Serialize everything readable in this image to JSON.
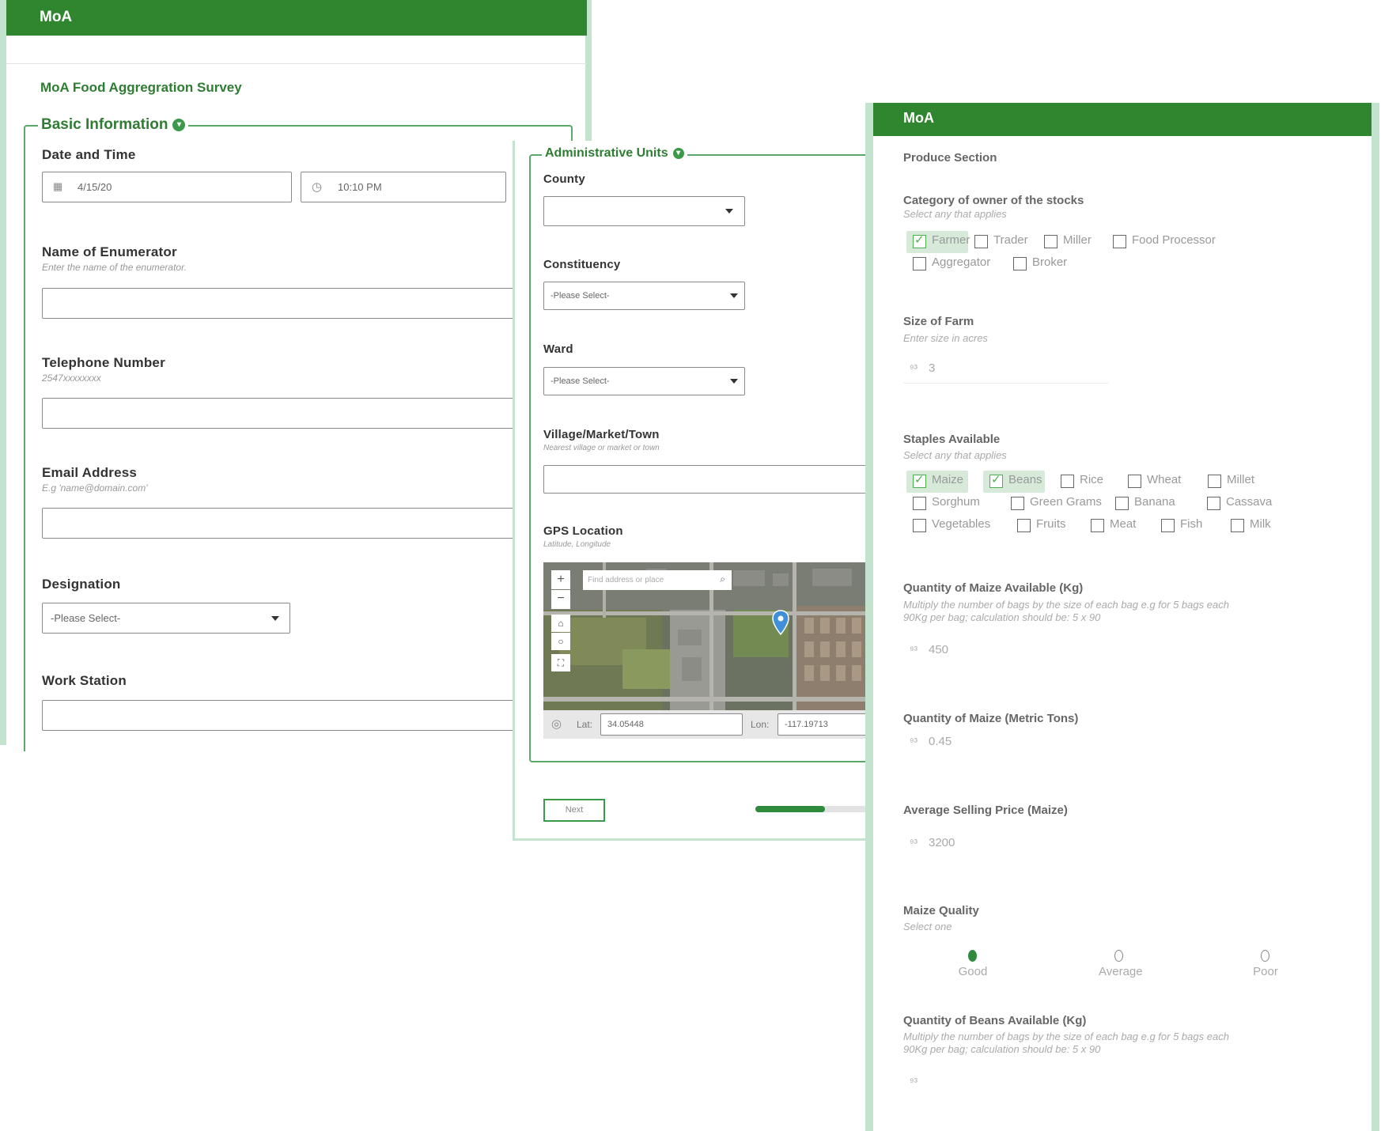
{
  "left_form": {
    "app_title": "MoA",
    "survey_title": "MoA Food Aggregration Survey",
    "section_title": "Basic Information",
    "date_time": {
      "label": "Date and Time",
      "date_value": "4/15/20",
      "time_value": "10:10 PM"
    },
    "enumerator": {
      "label": "Name of Enumerator",
      "hint": "Enter the name of the enumerator."
    },
    "telephone": {
      "label": "Telephone Number",
      "hint": "2547xxxxxxxx"
    },
    "email": {
      "label": "Email Address",
      "hint": "E.g 'name@domain.com'"
    },
    "designation": {
      "label": "Designation",
      "value": "-Please Select-"
    },
    "work_station": {
      "label": "Work Station"
    }
  },
  "middle_form": {
    "section_title": "Administrative Units",
    "county": {
      "label": "County",
      "value": ""
    },
    "constituency": {
      "label": "Constituency",
      "value": "-Please Select-"
    },
    "ward": {
      "label": "Ward",
      "value": "-Please Select-"
    },
    "village": {
      "label": "Village/Market/Town",
      "hint": "Nearest village or market or town"
    },
    "gps": {
      "label": "GPS Location",
      "hint": "Latitude, Longitude",
      "search_placeholder": "Find address or place",
      "lat_label": "Lat:",
      "lat_value": "34.05448",
      "lon_label": "Lon:",
      "lon_value": "-117.19713"
    },
    "next_label": "Next",
    "progress_fraction": 0.6
  },
  "right_form": {
    "app_title": "MoA",
    "section_title": "Produce Section",
    "owner_category": {
      "label": "Category of owner of the stocks",
      "hint": "Select any that applies",
      "options": [
        {
          "label": "Farmer",
          "checked": true
        },
        {
          "label": "Trader",
          "checked": false
        },
        {
          "label": "Miller",
          "checked": false
        },
        {
          "label": "Food Processor",
          "checked": false
        },
        {
          "label": "Aggregator",
          "checked": false
        },
        {
          "label": "Broker",
          "checked": false
        }
      ]
    },
    "farm_size": {
      "label": "Size of Farm",
      "hint": "Enter size in acres",
      "value": "3"
    },
    "staples": {
      "label": "Staples Available",
      "hint": "Select any that applies",
      "options": [
        {
          "label": "Maize",
          "checked": true
        },
        {
          "label": "Beans",
          "checked": true
        },
        {
          "label": "Rice",
          "checked": false
        },
        {
          "label": "Wheat",
          "checked": false
        },
        {
          "label": "Millet",
          "checked": false
        },
        {
          "label": "Sorghum",
          "checked": false
        },
        {
          "label": "Green Grams",
          "checked": false
        },
        {
          "label": "Banana",
          "checked": false
        },
        {
          "label": "Cassava",
          "checked": false
        },
        {
          "label": "Vegetables",
          "checked": false
        },
        {
          "label": "Fruits",
          "checked": false
        },
        {
          "label": "Meat",
          "checked": false
        },
        {
          "label": "Fish",
          "checked": false
        },
        {
          "label": "Milk",
          "checked": false
        }
      ]
    },
    "maize_kg": {
      "label": "Quantity of Maize Available (Kg)",
      "hint_line1": "Multiply the number of bags by the size of each bag e.g for 5 bags each",
      "hint_line2": "90Kg per bag; calculation should be: 5 x 90",
      "value": "450"
    },
    "maize_tons": {
      "label": "Quantity of Maize (Metric Tons)",
      "value": "0.45"
    },
    "maize_price": {
      "label": "Average Selling Price (Maize)",
      "value": "3200"
    },
    "maize_quality": {
      "label": "Maize Quality",
      "hint": "Select one",
      "options": [
        {
          "label": "Good",
          "selected": true
        },
        {
          "label": "Average",
          "selected": false
        },
        {
          "label": "Poor",
          "selected": false
        }
      ]
    },
    "beans_kg": {
      "label": "Quantity of Beans Available (Kg)",
      "hint_line1": "Multiply the number of bags by the size of each bag e.g for 5 bags each",
      "hint_line2": "90Kg per bag; calculation should be: 5 x 90",
      "value": ""
    },
    "number_icon": "number-icon"
  },
  "colors": {
    "brand_green": "#30862f",
    "light_green": "#c4e3cf",
    "accent_green": "#4caf50"
  }
}
